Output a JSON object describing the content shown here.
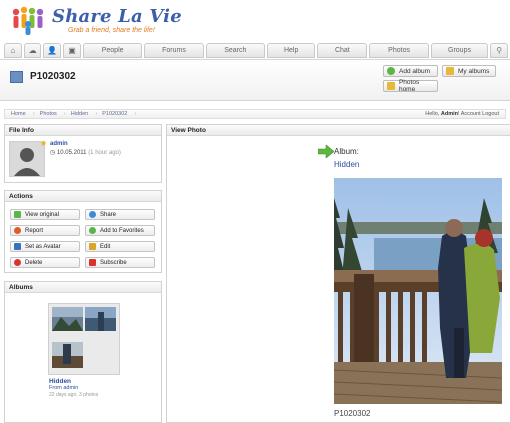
{
  "brand": {
    "name": "Share La Vie",
    "tagline": "Grab a friend, share the life!"
  },
  "nav": {
    "tabs": [
      "People",
      "Forums",
      "Search",
      "Help",
      "Chat",
      "Photos",
      "Groups"
    ]
  },
  "title": {
    "text": "P1020302"
  },
  "toolbar": {
    "add_album": "Add album",
    "my_albums": "My albums",
    "photos_home": "Photos home"
  },
  "breadcrumb": [
    "Home",
    "Photos",
    "Hidden",
    "P1020302"
  ],
  "session": {
    "hello": "Hello,",
    "user": "Admin",
    "account": "Account",
    "logout": "Logout"
  },
  "file_info": {
    "heading": "File Info",
    "owner": "admin",
    "date": "10.05.2011",
    "ago": "(1 hour ago)"
  },
  "actions": {
    "heading": "Actions",
    "view_original": "View original",
    "share": "Share",
    "report": "Report",
    "add_to_favorites": "Add to Favorites",
    "set_as_avatar": "Set as Avatar",
    "edit": "Edit",
    "delete": "Delete",
    "subscribe": "Subscribe"
  },
  "albums": {
    "heading": "Albums",
    "name": "Hidden",
    "from": "From admin",
    "meta": "22 days ago, 3 photos"
  },
  "view_photo": {
    "heading": "View Photo",
    "album_label": "Album:",
    "album_name": "Hidden",
    "photo_name": "P1020302"
  },
  "colors": {
    "brand_blue": "#3b5fa8",
    "tagline_orange": "#e07b20",
    "link_blue": "#2a4fa0"
  }
}
